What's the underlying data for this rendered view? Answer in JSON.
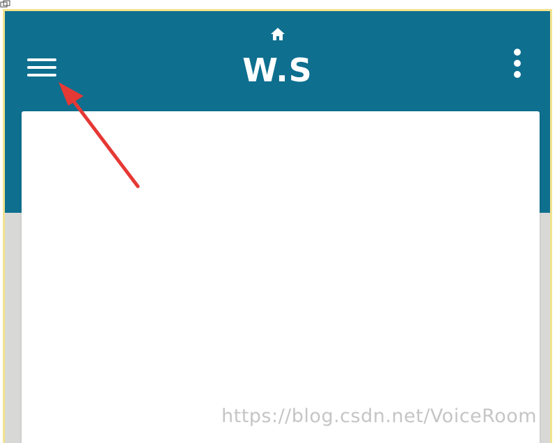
{
  "app": {
    "title": "W.S"
  },
  "header": {
    "home_icon": "home-icon",
    "menu_icon": "hamburger-menu-icon",
    "more_icon": "more-vertical-icon",
    "background_color": "#0e6f8f"
  },
  "annotation": {
    "arrow_color": "#e53935"
  },
  "watermark": {
    "text": "https://blog.csdn.net/VoiceRoom"
  }
}
